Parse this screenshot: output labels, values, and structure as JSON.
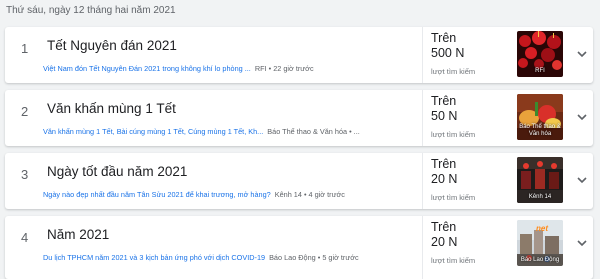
{
  "header": {
    "date": "Thứ sáu, ngày 12 tháng hai năm 2021"
  },
  "colors": {
    "background": "#f1f3f4",
    "card": "#ffffff",
    "link": "#1a73e8",
    "muted": "#5f6368"
  },
  "trends": [
    {
      "rank": "1",
      "title": "Tết Nguyên đán 2021",
      "article": "Việt Nam đón Tết Nguyên Đán 2021 trong không khí lo phòng ...",
      "meta": "RFI • 22 giờ trước",
      "count_prefix": "Trên",
      "count_value": "500 N",
      "count_label": "lượt tìm kiếm",
      "thumb_caption": "RFI",
      "thumb_icon": "lantern-image"
    },
    {
      "rank": "2",
      "title": "Văn khấn mùng 1 Tết",
      "article": "Văn khấn mùng 1 Tết, Bài cúng mùng 1 Tết, Cúng mùng 1 Tết, Kh...",
      "meta": "Báo Thể thao & Văn hóa • ...",
      "count_prefix": "Trên",
      "count_value": "50 N",
      "count_label": "lượt tìm kiếm",
      "thumb_caption": "Báo Thể thao & Văn hóa",
      "thumb_icon": "offering-image"
    },
    {
      "rank": "3",
      "title": "Ngày tốt đầu năm 2021",
      "article": "Ngày nào đẹp nhất đầu năm Tân Sửu 2021 để khai trương, mở hàng?",
      "meta": "Kênh 14 • 4 giờ trước",
      "count_prefix": "Trên",
      "count_value": "20 N",
      "count_label": "lượt tìm kiếm",
      "thumb_caption": "Kênh 14",
      "thumb_icon": "shop-image"
    },
    {
      "rank": "4",
      "title": "Năm 2021",
      "article": "Du lịch TPHCM năm 2021 và 3 kịch bản ứng phó với dịch COVID-19",
      "meta": "Báo Lao Động • 5 giờ trước",
      "count_prefix": "Trên",
      "count_value": "20 N",
      "count_label": "lượt tìm kiếm",
      "thumb_caption": "Báo Lao Động",
      "thumb_icon": "city-image",
      "thumb_logo": "net"
    }
  ]
}
